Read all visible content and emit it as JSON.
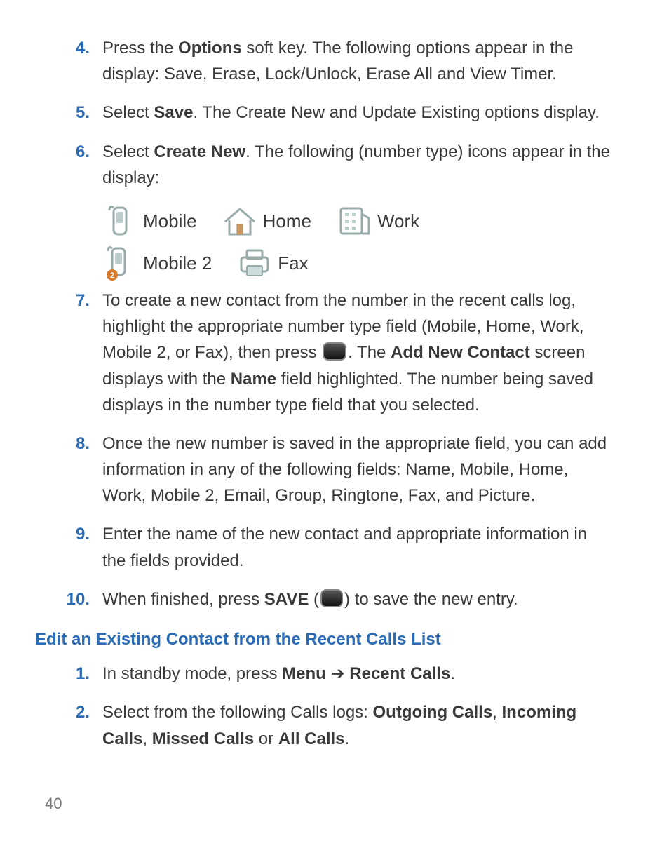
{
  "steps": {
    "s4": {
      "num": "4.",
      "pre": "Press the ",
      "b1": "Options",
      "post": " soft key. The following options appear in the display: Save, Erase, Lock/Unlock, Erase All and View Timer."
    },
    "s5": {
      "num": "5.",
      "pre": "Select ",
      "b1": "Save",
      "post": ". The Create New and Update Existing options display."
    },
    "s6": {
      "num": "6.",
      "pre": "Select ",
      "b1": "Create New",
      "post": ". The following (number type) icons appear in the display:"
    },
    "s7": {
      "num": "7.",
      "t1": "To create a new contact from the number in the recent calls log, highlight the appropriate number type field (Mobile, Home, Work, Mobile 2, or Fax), then press ",
      "t2": ". The ",
      "b2": "Add New Contact",
      "t3": " screen displays with the ",
      "b3": "Name",
      "t4": " field highlighted. The number being saved displays in the number type field that you selected."
    },
    "s8": {
      "num": "8.",
      "t": "Once the new number is saved in the appropriate field, you can add information in any of the following fields: Name, Mobile, Home, Work, Mobile 2, Email, Group, Ringtone, Fax, and Picture."
    },
    "s9": {
      "num": "9.",
      "t": "Enter the name of the new contact and appropriate information in the fields provided."
    },
    "s10": {
      "num": "10.",
      "t1": "When finished, press ",
      "b1": "SAVE",
      "t2": " (",
      "t3": ") to save the new entry."
    }
  },
  "icons": {
    "mobile": "Mobile",
    "home": "Home",
    "work": "Work",
    "mobile2": "Mobile 2",
    "fax": "Fax"
  },
  "section": "Edit an Existing Contact from the Recent Calls List",
  "steps2": {
    "e1": {
      "num": "1.",
      "t1": "In standby mode, press ",
      "b1": "Menu",
      "arrow": " ➔ ",
      "b2": "Recent Calls",
      "t2": "."
    },
    "e2": {
      "num": "2.",
      "t1": "Select from the following Calls logs: ",
      "b1": "Outgoing Calls",
      "c1": ", ",
      "b2": "Incoming Calls",
      "c2": ", ",
      "b3": "Missed Calls",
      "t2": " or ",
      "b4": "All Calls",
      "t3": "."
    }
  },
  "page": "40"
}
